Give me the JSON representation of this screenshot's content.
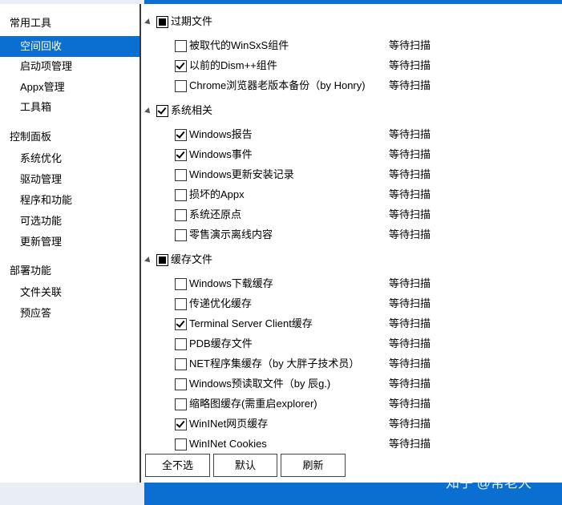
{
  "sidebar": {
    "sections": [
      {
        "label": "常用工具"
      },
      {
        "label": "控制面板"
      },
      {
        "label": "部署功能"
      }
    ],
    "items": [
      {
        "label": "空间回收",
        "selected": true
      },
      {
        "label": "启动项管理"
      },
      {
        "label": "Appx管理"
      },
      {
        "label": "工具箱"
      },
      {
        "label": "系统优化"
      },
      {
        "label": "驱动管理"
      },
      {
        "label": "程序和功能"
      },
      {
        "label": "可选功能"
      },
      {
        "label": "更新管理"
      },
      {
        "label": "文件关联"
      },
      {
        "label": "预应答"
      }
    ]
  },
  "groups": [
    {
      "label": "过期文件",
      "state": "partial",
      "rows": [
        {
          "label": "被取代的WinSxS组件",
          "checked": false,
          "status": "等待扫描"
        },
        {
          "label": "以前的Dism++组件",
          "checked": true,
          "status": "等待扫描"
        },
        {
          "label": "Chrome浏览器老版本备份（by Honry)",
          "checked": false,
          "status": "等待扫描"
        }
      ]
    },
    {
      "label": "系统相关",
      "state": "checked",
      "rows": [
        {
          "label": "Windows报告",
          "checked": true,
          "status": "等待扫描"
        },
        {
          "label": "Windows事件",
          "checked": true,
          "status": "等待扫描"
        },
        {
          "label": "Windows更新安装记录",
          "checked": false,
          "status": "等待扫描"
        },
        {
          "label": "损坏的Appx",
          "checked": false,
          "status": "等待扫描"
        },
        {
          "label": "系统还原点",
          "checked": false,
          "status": "等待扫描"
        },
        {
          "label": "零售演示离线内容",
          "checked": false,
          "status": "等待扫描"
        }
      ]
    },
    {
      "label": "缓存文件",
      "state": "partial",
      "rows": [
        {
          "label": "Windows下载缓存",
          "checked": false,
          "status": "等待扫描"
        },
        {
          "label": "传递优化缓存",
          "checked": false,
          "status": "等待扫描"
        },
        {
          "label": "Terminal Server Client缓存",
          "checked": true,
          "status": "等待扫描"
        },
        {
          "label": "PDB缓存文件",
          "checked": false,
          "status": "等待扫描"
        },
        {
          "label": "NET程序集缓存（by 大胖子技术员）",
          "checked": false,
          "status": "等待扫描"
        },
        {
          "label": "Windows预读取文件（by 辰g.)",
          "checked": false,
          "status": "等待扫描"
        },
        {
          "label": "缩略图缓存(需重启explorer)",
          "checked": false,
          "status": "等待扫描"
        },
        {
          "label": "WinINet网页缓存",
          "checked": true,
          "status": "等待扫描"
        },
        {
          "label": "WinINet Cookies",
          "checked": false,
          "status": "等待扫描"
        }
      ]
    }
  ],
  "buttons": {
    "deselect_all": "全不选",
    "default": "默认",
    "refresh": "刷新"
  },
  "watermark": "知乎 @常老大",
  "colors": {
    "accent": "#0a6fd1"
  }
}
